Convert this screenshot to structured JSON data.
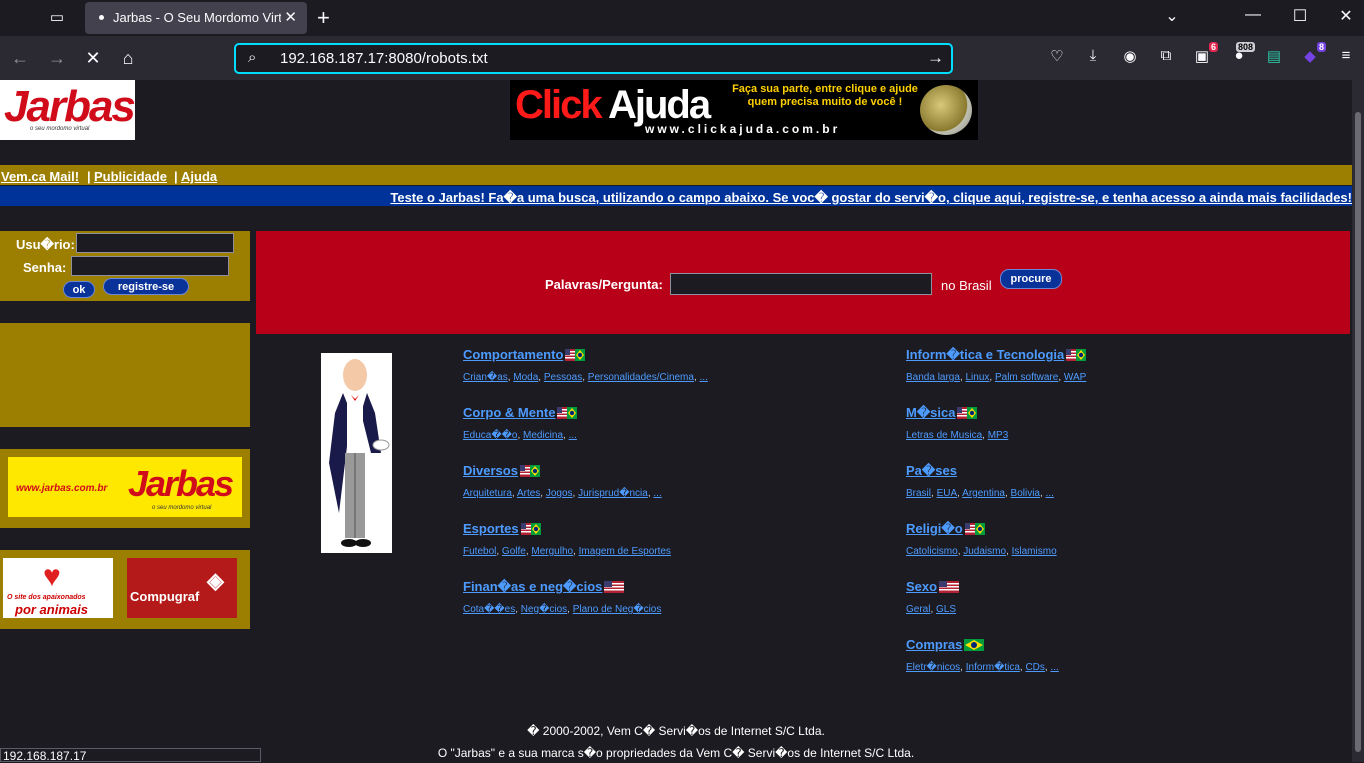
{
  "browser": {
    "tab_title": "Jarbas - O Seu Mordomo Virtual",
    "url": "192.168.187.17:8080/robots.txt",
    "badges": {
      "ext1": "6",
      "ext2": "808",
      "ext3": "8"
    },
    "status_text": "192.168.187.17"
  },
  "logo": {
    "name": "Jarbas",
    "tagline": "o seu mordomo virtual"
  },
  "banner": {
    "brand_click": "Click",
    "brand_ajuda": "Ajuda",
    "slogan": "Faça sua parte, entre clique e ajude quem precisa muito de você !",
    "site": "www.clickajuda.com.br"
  },
  "topnav": {
    "mail": "Vem.ca Mail!",
    "sep": "|",
    "ads": "Publicidade",
    "help": "Ajuda"
  },
  "promo": "Teste o Jarbas! Fa�a uma busca, utilizando o campo abaixo. Se voc� gostar do servi�o, clique aqui, registre-se, e tenha acesso a ainda mais facilidades!",
  "login": {
    "user_label": "Usu�rio:",
    "pass_label": "Senha:",
    "ok": "ok",
    "register": "registre-se"
  },
  "search": {
    "label": "Palavras/Pergunta:",
    "scope": "no Brasil",
    "button": "procure"
  },
  "side_ads": {
    "jarbas_url": "www.jarbas.com.br",
    "jarbas_name": "Jarbas",
    "jarbas_tagline": "o seu mordomo virtual",
    "animais_1": "O site dos apaixonados",
    "animais_2": "por animais",
    "compugraf": "Compugraf"
  },
  "categories_left": [
    {
      "title": "Comportamento",
      "flag": "us-br",
      "subs": [
        "Crian�as",
        "Moda",
        "Pessoas",
        "Personalidades/Cinema",
        "..."
      ]
    },
    {
      "title": "Corpo & Mente",
      "flag": "us-br",
      "subs": [
        "Educa��o",
        "Medicina",
        "..."
      ]
    },
    {
      "title": "Diversos",
      "flag": "us-br",
      "subs": [
        "Arquitetura",
        "Artes",
        "Jogos",
        "Jurisprud�ncia",
        "..."
      ]
    },
    {
      "title": "Esportes",
      "flag": "us-br",
      "subs": [
        "Futebol",
        "Golfe",
        "Mergulho",
        "Imagem de Esportes"
      ]
    },
    {
      "title": "Finan�as e neg�cios",
      "flag": "us",
      "subs": [
        "Cota��es",
        "Neg�cios",
        "Plano de Neg�cios"
      ]
    }
  ],
  "categories_right": [
    {
      "title": "Inform�tica e Tecnologia",
      "flag": "us-br",
      "subs": [
        "Banda larga",
        "Linux",
        "Palm software",
        "WAP"
      ]
    },
    {
      "title": "M�sica",
      "flag": "us-br",
      "subs": [
        "Letras de Musica",
        "MP3"
      ]
    },
    {
      "title": "Pa�ses",
      "flag": "none",
      "subs": [
        "Brasil",
        "EUA",
        "Argentina",
        "Bolivia",
        "..."
      ]
    },
    {
      "title": "Religi�o",
      "flag": "us-br",
      "subs": [
        "Catolicismo",
        "Judaismo",
        "Islamismo"
      ]
    },
    {
      "title": "Sexo",
      "flag": "us",
      "subs": [
        "Geral",
        "GLS"
      ]
    },
    {
      "title": "Compras",
      "flag": "br",
      "subs": [
        "Eletr�nicos",
        "Inform�tica",
        "CDs",
        "..."
      ]
    }
  ],
  "footer": {
    "line1": "� 2000-2002, Vem C� Servi�os de Internet S/C Ltda.",
    "line2": "O \"Jarbas\" e a sua marca s�o propriedades da Vem C� Servi�os de Internet S/C Ltda."
  },
  "colors": {
    "gold": "#9c7e00",
    "red": "#b80018",
    "blue": "#003399",
    "link": "#4d9bff"
  }
}
